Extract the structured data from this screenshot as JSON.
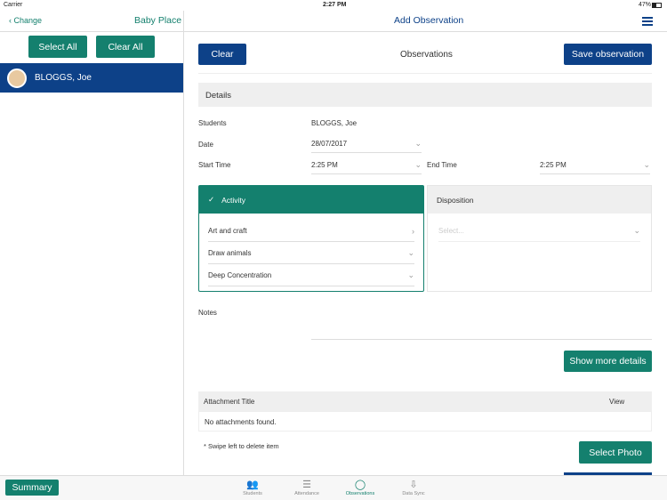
{
  "status": {
    "carrier": "Carrier",
    "time": "2:27 PM",
    "battery": "47%"
  },
  "sidebar": {
    "back": "Change",
    "title": "Baby Place",
    "select_all": "Select All",
    "clear_all": "Clear All",
    "students": [
      {
        "name": "BLOGGS, Joe"
      }
    ],
    "summary": "Summary"
  },
  "header": {
    "title": "Add Observation"
  },
  "toolbar": {
    "clear": "Clear",
    "title": "Observations",
    "save": "Save observation"
  },
  "details": {
    "heading": "Details",
    "students_label": "Students",
    "students_value": "BLOGGS, Joe",
    "date_label": "Date",
    "date_value": "28/07/2017",
    "start_label": "Start Time",
    "start_value": "2:25 PM",
    "end_label": "End Time",
    "end_value": "2:25 PM"
  },
  "activity": {
    "heading": "Activity",
    "items": [
      "Art and craft",
      "Draw animals",
      "Deep Concentration"
    ]
  },
  "disposition": {
    "heading": "Disposition",
    "placeholder": "Select..."
  },
  "notes": {
    "label": "Notes"
  },
  "more": "Show more details",
  "attachments": {
    "col_title": "Attachment Title",
    "col_view": "View",
    "empty": "No attachments found.",
    "hint": "* Swipe left to delete item",
    "select_photo": "Select Photo"
  },
  "tabs": [
    {
      "label": "Students",
      "icon": "people-icon"
    },
    {
      "label": "Attendance",
      "icon": "checklist-icon"
    },
    {
      "label": "Observations",
      "icon": "chat-bubble-icon",
      "active": true
    },
    {
      "label": "Data Sync",
      "icon": "download-icon"
    }
  ],
  "colors": {
    "green": "#14806e",
    "blue": "#0d4188"
  }
}
